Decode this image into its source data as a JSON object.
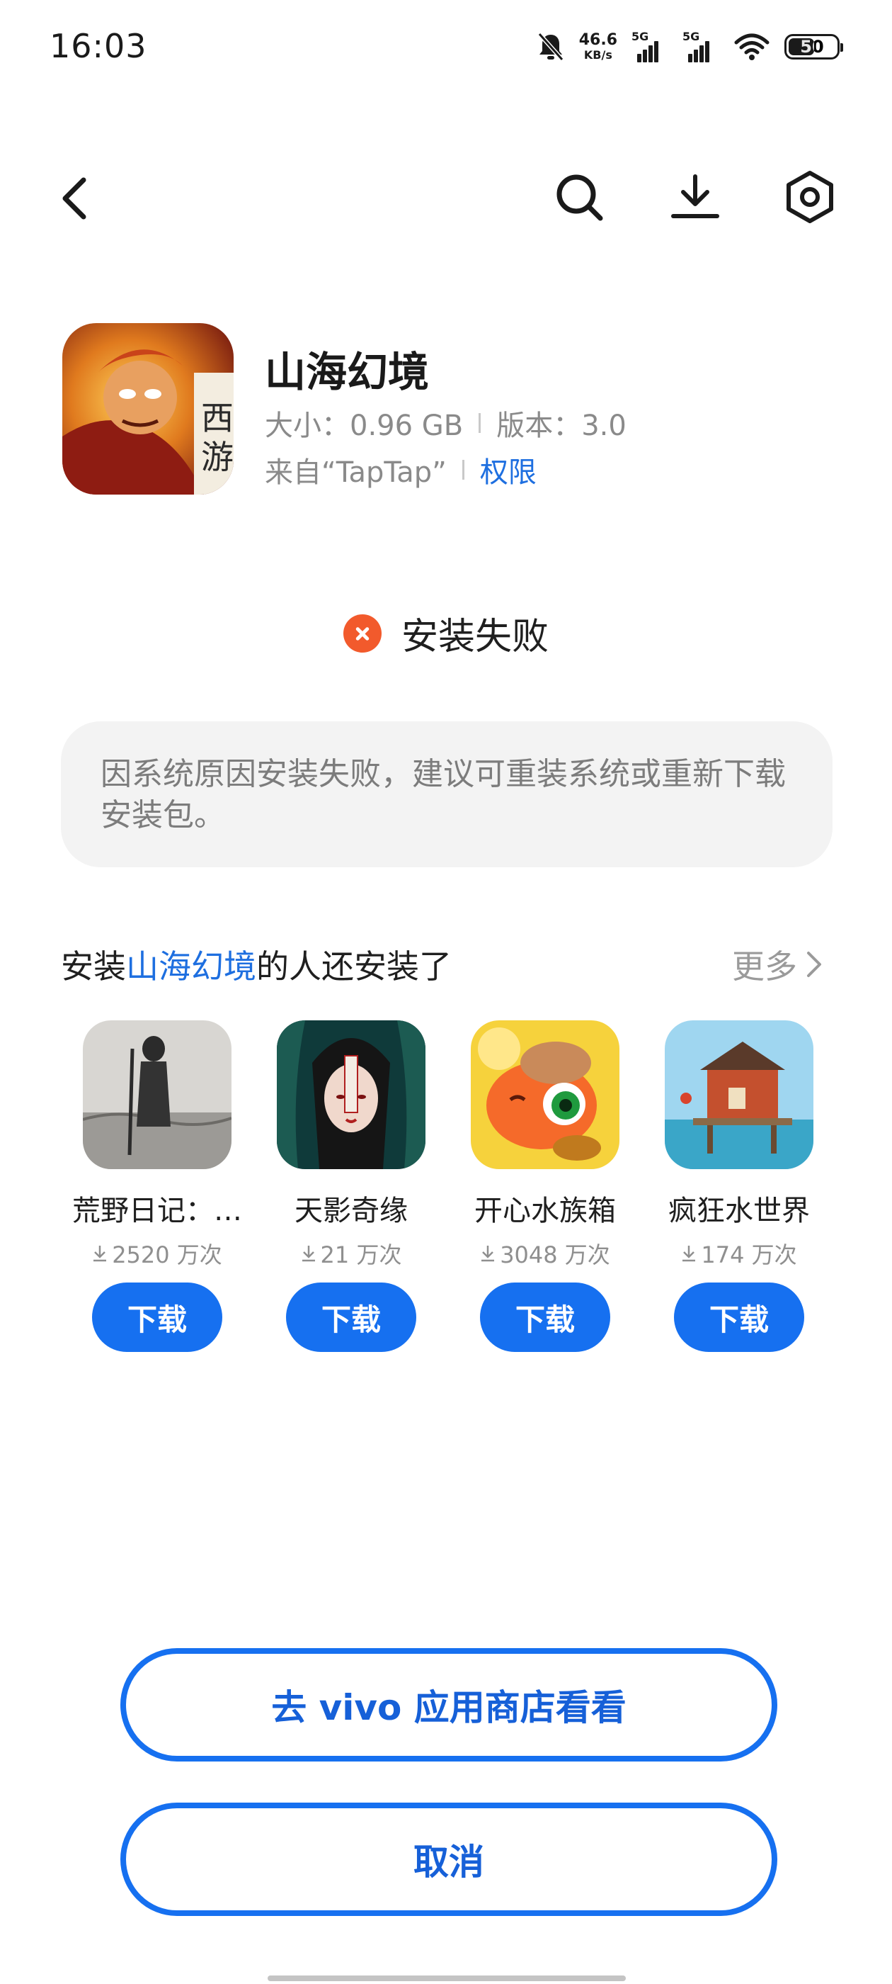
{
  "status_bar": {
    "time": "16:03",
    "net_speed_value": "46.6",
    "net_speed_unit": "KB/s",
    "signal_1": "5G",
    "signal_2": "5G",
    "battery": "50",
    "icons": [
      "mute-bell-icon",
      "wifi-icon",
      "battery-icon"
    ]
  },
  "nav": {
    "icons": [
      "back-icon",
      "search-icon",
      "download-icon",
      "settings-icon"
    ]
  },
  "app": {
    "name": "山海幻境",
    "size_label": "大小：0.96 GB",
    "version_label": "版本：3.0",
    "source_label": "来自“TapTap”",
    "permission_link": "权限"
  },
  "install_status": {
    "text": "安装失败",
    "reason": "因系统原因安装失败，建议可重装系统或重新下载安装包。"
  },
  "recommendations": {
    "title_prefix": "安装",
    "title_app": "山海幻境",
    "title_suffix": "的人还安装了",
    "more_label": "更多",
    "download_label": "下载",
    "items": [
      {
        "name": "荒野日记：…",
        "downloads": "2520 万次"
      },
      {
        "name": "天影奇缘",
        "downloads": "21 万次"
      },
      {
        "name": "开心水族箱",
        "downloads": "3048 万次"
      },
      {
        "name": "疯狂水世界",
        "downloads": "174 万次"
      }
    ]
  },
  "actions": {
    "store_button": "去 vivo 应用商店看看",
    "cancel_button": "取消"
  },
  "colors": {
    "accent": "#1670f0",
    "error": "#f25a2c"
  }
}
